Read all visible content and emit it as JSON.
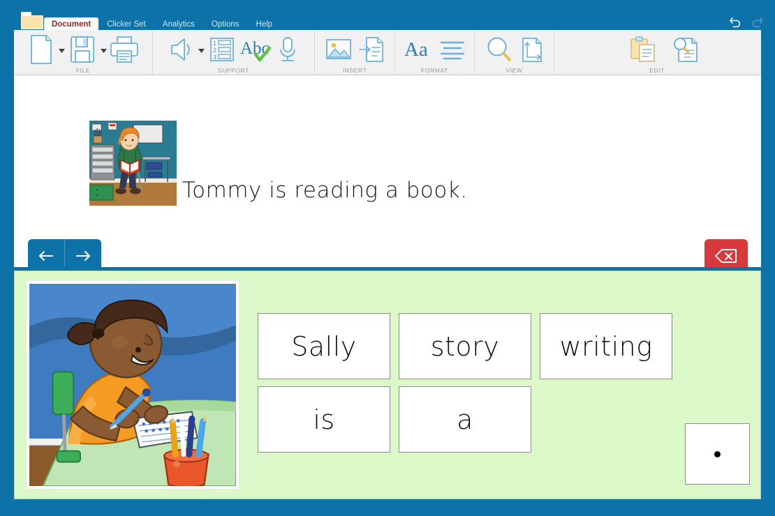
{
  "window": {
    "title_icon": "folder-icon",
    "tabs": [
      {
        "label": "Document",
        "active": true
      },
      {
        "label": "Clicker Set",
        "active": false
      },
      {
        "label": "Analytics",
        "active": false
      },
      {
        "label": "Options",
        "active": false
      },
      {
        "label": "Help",
        "active": false
      }
    ],
    "controls": [
      {
        "name": "undo-icon",
        "enabled": true
      },
      {
        "name": "redo-icon",
        "enabled": false
      }
    ],
    "chrome_color": "#0d72a8"
  },
  "ribbon": {
    "groups": [
      {
        "label": "FILE",
        "tools": [
          {
            "name": "new-document-icon",
            "has_caret": true
          },
          {
            "name": "save-icon",
            "has_caret": true
          },
          {
            "name": "print-icon",
            "has_caret": false
          }
        ]
      },
      {
        "label": "SUPPORT",
        "tools": [
          {
            "name": "speaker-icon",
            "has_caret": true
          },
          {
            "name": "numbered-list-icon",
            "has_caret": false
          },
          {
            "name": "spellcheck-abc-icon",
            "has_caret": false
          },
          {
            "name": "microphone-icon",
            "has_caret": false
          }
        ]
      },
      {
        "label": "INSERT",
        "tools": [
          {
            "name": "insert-picture-icon",
            "has_caret": false
          },
          {
            "name": "insert-into-document-icon",
            "has_caret": false
          }
        ]
      },
      {
        "label": "FORMAT",
        "tools": [
          {
            "name": "font-aa-icon",
            "has_caret": false
          },
          {
            "name": "paragraph-align-icon",
            "has_caret": false
          }
        ]
      },
      {
        "label": "VIEW",
        "tools": [
          {
            "name": "zoom-magnifier-icon",
            "has_caret": false
          },
          {
            "name": "page-layout-icon",
            "has_caret": false
          }
        ]
      },
      {
        "label": "EDIT",
        "tools": [
          {
            "name": "paste-clipboard-icon",
            "has_caret": false
          },
          {
            "name": "find-in-document-icon",
            "has_caret": false
          }
        ]
      }
    ]
  },
  "document": {
    "image_alt": "boy-reading-book-in-classroom",
    "sentence": "Tommy is reading a book."
  },
  "toolbar_buttons": {
    "back": {
      "name": "back-arrow-button",
      "glyph": "←",
      "color": "#0d72a8"
    },
    "forward": {
      "name": "forward-arrow-button",
      "glyph": "→",
      "color": "#0d72a8"
    },
    "delete": {
      "name": "backspace-delete-button",
      "glyph": "⌫",
      "color": "#d8393c"
    }
  },
  "grid": {
    "background_color": "#dcf8c8",
    "picture_alt": "girl-writing-at-desk",
    "word_rows": [
      [
        "Sally",
        "story",
        "writing"
      ],
      [
        "is",
        "a"
      ]
    ],
    "punctuation_card": {
      "label": "·",
      "name": "full-stop-card"
    }
  }
}
